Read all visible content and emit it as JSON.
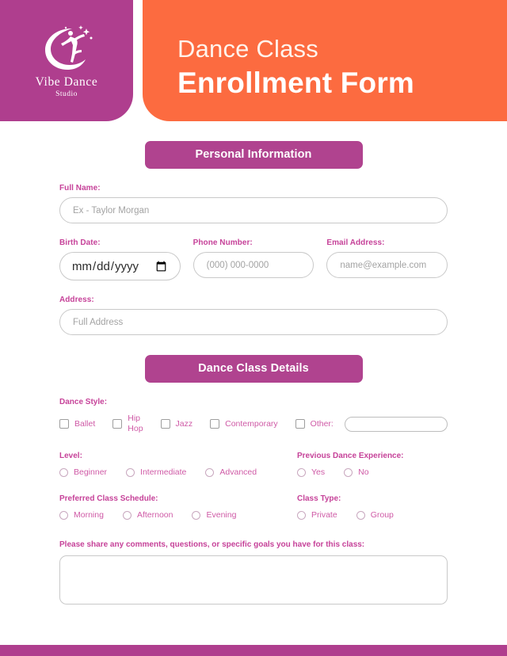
{
  "header": {
    "logo": {
      "icon": "crescent-moon-dancer-logo",
      "name": "Vibe Dance",
      "sub": "Studio"
    },
    "title_line1": "Dance Class",
    "title_line2": "Enrollment Form"
  },
  "colors": {
    "purple": "#AF3E8E",
    "banner_purple": "#B0438F",
    "orange": "#FC6B40",
    "label_pink": "#C64299",
    "option_pink": "#CF5AA6",
    "input_border": "#C9C9C9",
    "placeholder": "#A3A3A3"
  },
  "sections": {
    "personal": "Personal Information",
    "class_details": "Dance Class Details"
  },
  "personal": {
    "full_name": {
      "label": "Full Name:",
      "placeholder": "Ex - Taylor Morgan",
      "value": ""
    },
    "birth_date": {
      "label": "Birth Date:",
      "placeholder": "mm/dd/yyyy",
      "value": "",
      "icon": "calendar-icon"
    },
    "phone": {
      "label": "Phone Number:",
      "placeholder": "(000) 000-0000",
      "value": ""
    },
    "email": {
      "label": "Email Address:",
      "placeholder": "name@example.com",
      "value": ""
    },
    "address": {
      "label": "Address:",
      "placeholder": "Full Address",
      "value": ""
    }
  },
  "class_details": {
    "dance_style": {
      "label": "Dance Style:",
      "options": [
        {
          "label": "Ballet",
          "checked": false
        },
        {
          "label": "Hip\nHop",
          "checked": false
        },
        {
          "label": "Jazz",
          "checked": false
        },
        {
          "label": "Contemporary",
          "checked": false
        },
        {
          "label": "Other:",
          "checked": false
        }
      ],
      "other_value": "",
      "other_placeholder": ""
    },
    "level": {
      "label": "Level:",
      "options": [
        {
          "label": "Beginner",
          "selected": false
        },
        {
          "label": "Intermediate",
          "selected": false
        },
        {
          "label": "Advanced",
          "selected": false
        }
      ]
    },
    "previous_experience": {
      "label": "Previous Dance Experience:",
      "options": [
        {
          "label": "Yes",
          "selected": false
        },
        {
          "label": "No",
          "selected": false
        }
      ]
    },
    "schedule": {
      "label": "Preferred Class Schedule:",
      "options": [
        {
          "label": "Morning",
          "selected": false
        },
        {
          "label": "Afternoon",
          "selected": false
        },
        {
          "label": "Evening",
          "selected": false
        }
      ]
    },
    "class_type": {
      "label": "Class Type:",
      "options": [
        {
          "label": "Private",
          "selected": false
        },
        {
          "label": "Group",
          "selected": false
        }
      ]
    },
    "comments": {
      "label": "Please share any comments, questions, or specific goals you have for this class:",
      "value": "",
      "placeholder": ""
    }
  }
}
